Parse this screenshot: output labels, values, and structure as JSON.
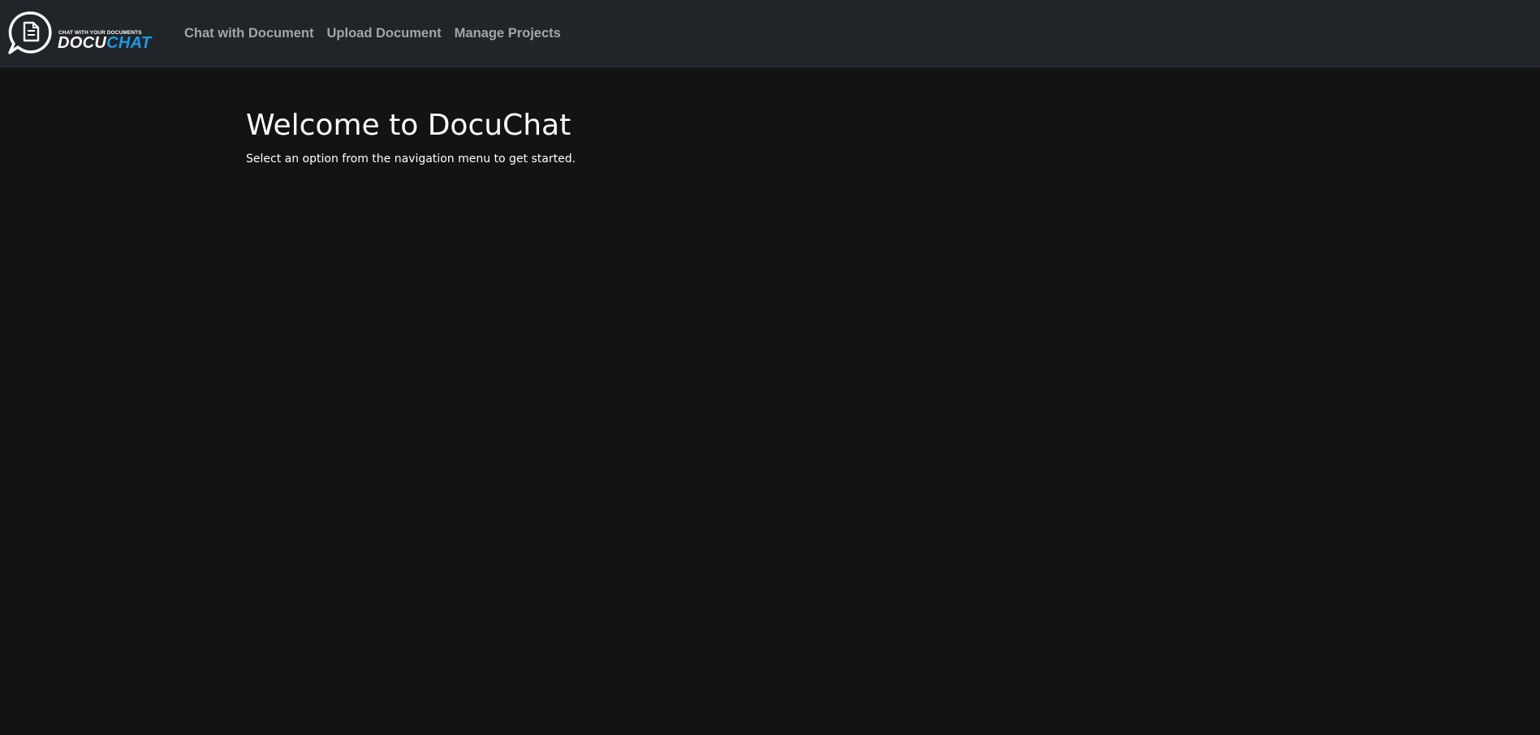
{
  "header": {
    "logo": {
      "icon": "chat-document-icon",
      "tagline": "CHAT WITH YOUR DOCUMENTS",
      "word_part1": "DOCU",
      "word_part2": "CHAT",
      "accent_color": "#1a9be6"
    },
    "nav": [
      {
        "label": "Chat with Document"
      },
      {
        "label": "Upload Document"
      },
      {
        "label": "Manage Projects"
      }
    ]
  },
  "main": {
    "title": "Welcome to DocuChat",
    "subtitle": "Select an option from the navigation menu to get started."
  },
  "colors": {
    "background": "#131313",
    "navbar": "#212429",
    "nav_link": "#a3a5a8",
    "text": "#ffffff"
  }
}
